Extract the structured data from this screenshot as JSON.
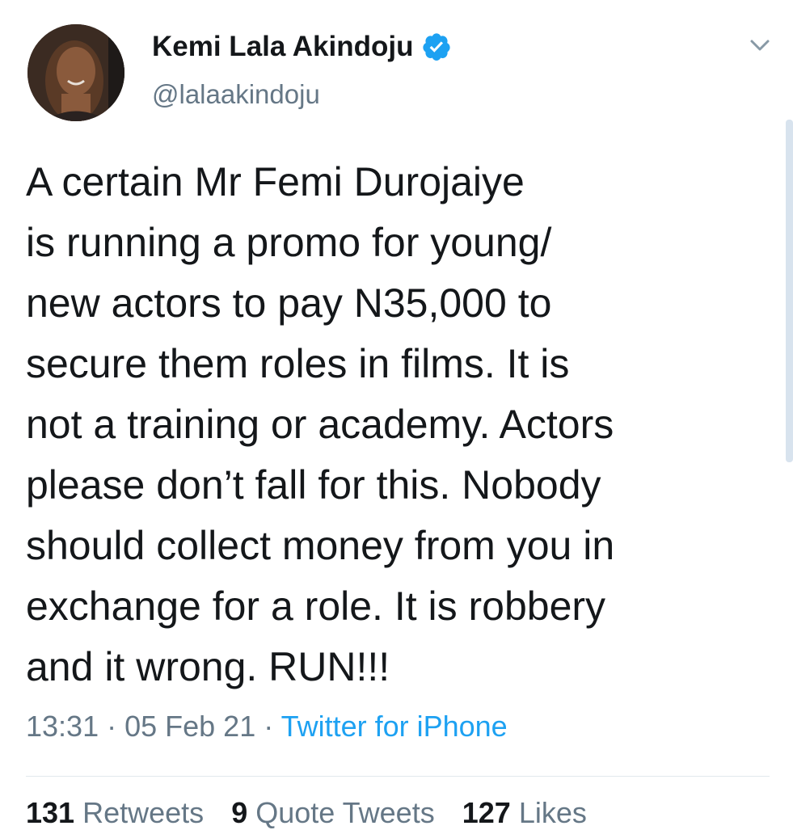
{
  "profile": {
    "display_name": "Kemi Lala Akindoju",
    "handle": "@lalaakindoju",
    "verified": true,
    "avatar_icon": "profile-photo"
  },
  "tweet": {
    "lines": [
      "A certain Mr Femi Durojaiye",
      "is running a promo for young/",
      "new actors to pay N35,000 to",
      "secure them roles in films. It is",
      "not a training or academy. Actors",
      "please don’t fall for this. Nobody",
      "should collect money from you in",
      "exchange for a role. It is robbery",
      "and it wrong. RUN!!!"
    ]
  },
  "meta": {
    "time": "13:31",
    "separator": " · ",
    "date": "05 Feb 21",
    "source": "Twitter for iPhone"
  },
  "stats": {
    "retweets_count": "131",
    "retweets_label": "Retweets",
    "quotes_count": "9",
    "quotes_label": "Quote Tweets",
    "likes_count": "127",
    "likes_label": "Likes"
  },
  "colors": {
    "accent": "#1da1f2",
    "text": "#14171a",
    "muted": "#657786"
  },
  "icons": {
    "verified": "verified-badge-icon",
    "menu": "chevron-down-icon"
  }
}
